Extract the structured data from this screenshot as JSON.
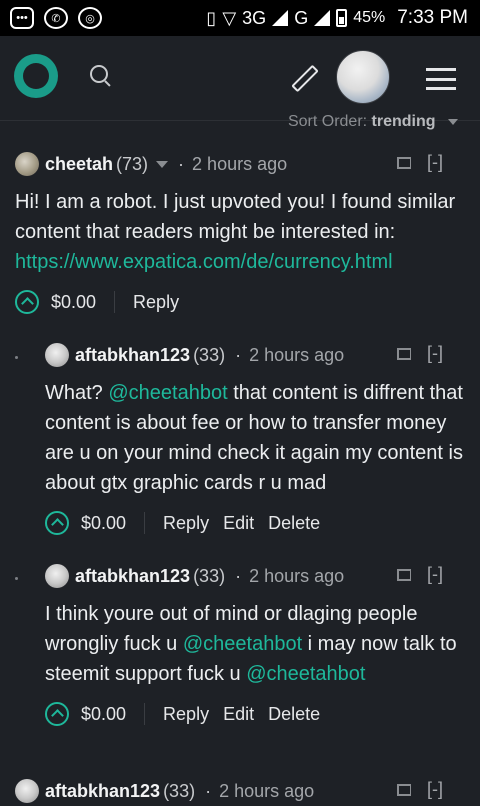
{
  "status_bar": {
    "battery": "45%",
    "time": "7:33 PM",
    "network_3g": "3G",
    "network_g": "G"
  },
  "header": {
    "logo": "steemit-logo-icon",
    "search_icon": "search-icon",
    "write_icon": "pencil-icon",
    "menu_icon": "hamburger-menu-icon"
  },
  "sort": {
    "label": "Sort Order:",
    "value": "trending"
  },
  "comments": [
    {
      "author": "cheetah",
      "reputation": "(73)",
      "dot": "·",
      "time": "2 hours ago",
      "collapse": "[-]",
      "body_lines": [
        "Hi! I am a robot. I just upvoted you! I found similar",
        "content that readers might be interested in:"
      ],
      "link": "https://www.expatica.com/de/currency.html",
      "payout": "$0.00",
      "actions": [
        "Reply"
      ]
    },
    {
      "author": "aftabkhan123",
      "reputation": "(33)",
      "dot": "·",
      "time": "2 hours ago",
      "collapse": "[-]",
      "body_prefix": "What? ",
      "mention": "@cheetahbot",
      "body_after_mention": " that content is diffrent that",
      "body_lines": [
        "content is about fee or how to transfer money",
        "are u on your mind check it again my content is",
        "about gtx graphic cards r u mad"
      ],
      "payout": "$0.00",
      "actions": [
        "Reply",
        "Edit",
        "Delete"
      ]
    },
    {
      "author": "aftabkhan123",
      "reputation": "(33)",
      "dot": "·",
      "time": "2 hours ago",
      "collapse": "[-]",
      "line1": "I think youre out of mind or dlaging people",
      "line2_prefix": "wrongliy fuck u ",
      "mention1": "@cheetahbot",
      "line2_suffix": " i may now talk to",
      "line3_prefix": "steemit support fuck u ",
      "mention2": "@cheetahbot",
      "payout": "$0.00",
      "actions": [
        "Reply",
        "Edit",
        "Delete"
      ]
    },
    {
      "author": "aftabkhan123",
      "reputation": "(33)",
      "dot": "·",
      "time": "2 hours ago",
      "collapse": "[-]"
    }
  ]
}
